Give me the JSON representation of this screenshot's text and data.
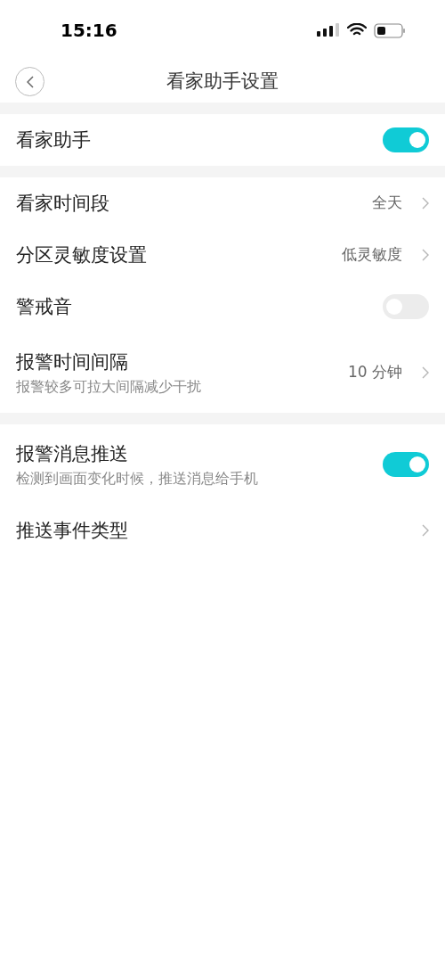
{
  "status_bar": {
    "time": "15:16"
  },
  "nav": {
    "title": "看家助手设置"
  },
  "sections": [
    {
      "rows": [
        {
          "kind": "toggle",
          "label": "看家助手",
          "on": true
        }
      ]
    },
    {
      "rows": [
        {
          "kind": "link",
          "label": "看家时间段",
          "value": "全天"
        },
        {
          "kind": "link",
          "label": "分区灵敏度设置",
          "value": "低灵敏度"
        },
        {
          "kind": "toggle",
          "label": "警戒音",
          "on": false
        },
        {
          "kind": "link",
          "label": "报警时间间隔",
          "subtitle": "报警较多可拉大间隔减少干扰",
          "value": "10 分钟"
        }
      ]
    },
    {
      "rows": [
        {
          "kind": "toggle",
          "label": "报警消息推送",
          "subtitle": "检测到画面变化时候，推送消息给手机",
          "on": true
        },
        {
          "kind": "link",
          "label": "推送事件类型"
        }
      ]
    }
  ]
}
